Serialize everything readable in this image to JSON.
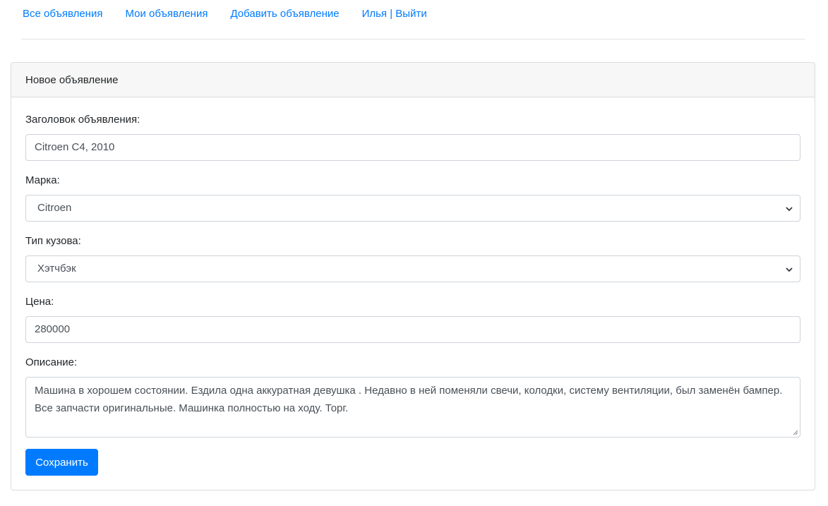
{
  "nav": {
    "all_ads": "Все объявления",
    "my_ads": "Мои объявления",
    "add_ad": "Добавить объявление",
    "user_logout": "Илья | Выйти"
  },
  "card": {
    "title": "Новое объявление"
  },
  "form": {
    "title_label": "Заголовок объявления:",
    "title_value": "Citroen C4, 2010",
    "brand_label": "Марка:",
    "brand_value": "Citroen",
    "body_type_label": "Тип кузова:",
    "body_type_value": "Хэтчбэк",
    "price_label": "Цена:",
    "price_value": "280000",
    "description_label": "Описание:",
    "description_value": "Машина в хорошем состоянии. Ездила одна аккуратная девушка . Недавно в ней поменяли свечи, колодки, систему вентиляции, был заменён бампер. Все запчасти оригинальные. Машинка полностью на ходу. Торг.",
    "save_label": "Сохранить"
  },
  "colors": {
    "link": "#007bff",
    "primary_button": "#007bff"
  },
  "icons": {
    "select_arrow": "chevron-down-icon",
    "textarea_resize": "resize-handle-icon"
  }
}
